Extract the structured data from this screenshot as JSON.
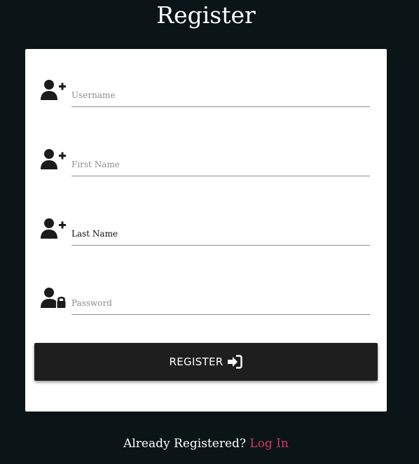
{
  "page": {
    "title": "Register"
  },
  "form": {
    "username": {
      "value": "",
      "placeholder": "Username",
      "icon": "user-plus-icon"
    },
    "first_name": {
      "value": "",
      "placeholder": "First Name",
      "icon": "user-plus-icon"
    },
    "last_name": {
      "value": "Last Name",
      "placeholder": "Last Name",
      "icon": "user-plus-icon"
    },
    "password": {
      "value": "",
      "placeholder": "Password",
      "icon": "user-lock-icon"
    },
    "submit_label": "REGISTER",
    "submit_icon": "sign-in-icon"
  },
  "footer": {
    "prompt": "Already Registered?",
    "login_link": "Log In"
  },
  "colors": {
    "background": "#0b1518",
    "card": "#ffffff",
    "button": "#1e1e1e",
    "link": "#d0365f"
  }
}
